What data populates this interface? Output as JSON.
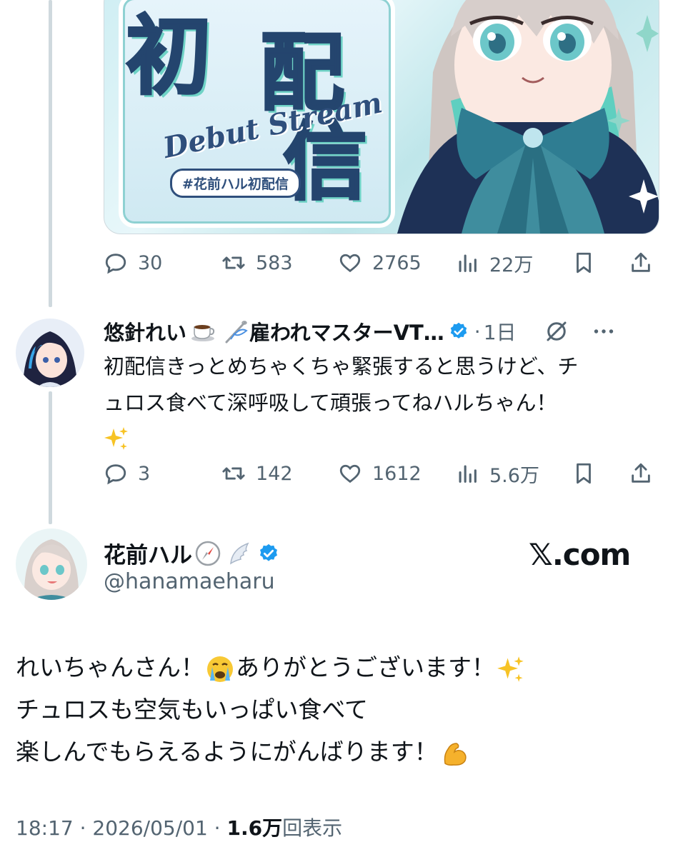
{
  "first_tweet": {
    "media": {
      "title_kanji": [
        "初",
        "配",
        "信"
      ],
      "subtitle": "Debut Stream",
      "hashtag": "#花前ハル初配信"
    },
    "stats": {
      "replies": "30",
      "reposts": "583",
      "likes": "2765",
      "views": "22万"
    }
  },
  "reply_tweet": {
    "display_name": "悠針れい",
    "name_suffix": "雇われマスターVT…",
    "time": "1日",
    "text_line1": "初配信きっとめちゃくちゃ緊張すると思うけど、チ",
    "text_line2": "ュロス食べて深呼吸して頑張ってねハルちゃん！",
    "stats": {
      "replies": "3",
      "reposts": "142",
      "likes": "1612",
      "views": "5.6万"
    }
  },
  "main_tweet": {
    "display_name": "花前ハル",
    "handle": "@hanamaeharu",
    "watermark": "𝕏.com",
    "line1": "れいちゃんさん！",
    "line1b": "ありがとうございます！",
    "line2": "チュロスも空気もいっぱい食べて",
    "line3": "楽しんでもらえるようにがんばります！",
    "timestamp": "18:17 · 2026/05/01 · ",
    "views_count": "1.6万",
    "views_label": "回表示"
  },
  "icons": [
    "reply-icon",
    "repost-icon",
    "like-icon",
    "views-icon",
    "bookmark-icon",
    "share-icon",
    "verified-badge-icon",
    "grok-icon",
    "more-icon",
    "coffee-emoji",
    "needle-emoji",
    "compass-emoji",
    "wing-emoji",
    "crying-emoji",
    "sparkles-emoji",
    "muscle-emoji"
  ],
  "colors": {
    "text": "#0f1419",
    "muted": "#536471",
    "verified": "#1d9bf0",
    "thread_line": "#cfd9de"
  }
}
